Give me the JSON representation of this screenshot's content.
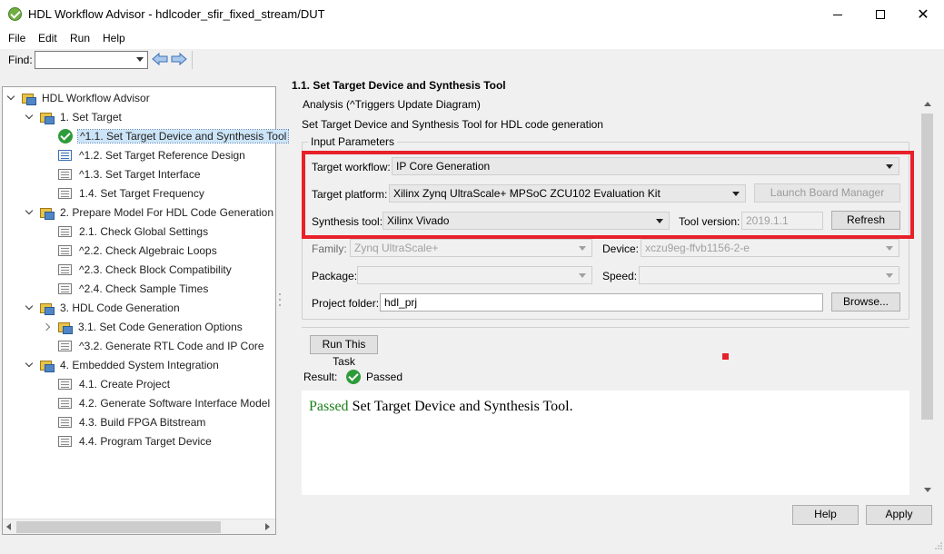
{
  "window": {
    "title": "HDL Workflow Advisor - hdlcoder_sfir_fixed_stream/DUT"
  },
  "menu": {
    "items": [
      "File",
      "Edit",
      "Run",
      "Help"
    ]
  },
  "findbar": {
    "label": "Find:",
    "value": ""
  },
  "tree": {
    "root": "HDL Workflow Advisor",
    "items": [
      {
        "label": "1. Set Target"
      },
      {
        "label": "^1.1. Set Target Device and Synthesis Tool"
      },
      {
        "label": "^1.2. Set Target Reference Design"
      },
      {
        "label": "^1.3. Set Target Interface"
      },
      {
        "label": "1.4. Set Target Frequency"
      },
      {
        "label": "2. Prepare Model For HDL Code Generation"
      },
      {
        "label": "2.1. Check Global Settings"
      },
      {
        "label": "^2.2. Check Algebraic Loops"
      },
      {
        "label": "^2.3. Check Block Compatibility"
      },
      {
        "label": "^2.4. Check Sample Times"
      },
      {
        "label": "3. HDL Code Generation"
      },
      {
        "label": "3.1. Set Code Generation Options"
      },
      {
        "label": "^3.2. Generate RTL Code and IP Core"
      },
      {
        "label": "4. Embedded System Integration"
      },
      {
        "label": "4.1. Create Project"
      },
      {
        "label": "4.2. Generate Software Interface Model"
      },
      {
        "label": "4.3. Build FPGA Bitstream"
      },
      {
        "label": "4.4. Program Target Device"
      }
    ]
  },
  "panel": {
    "title": "1.1. Set Target Device and Synthesis Tool",
    "analysis": "Analysis (^Triggers Update Diagram)",
    "description": "Set Target Device and Synthesis Tool for HDL code generation",
    "group_label": "Input Parameters",
    "target_workflow": {
      "label": "Target workflow:",
      "value": "IP Core Generation"
    },
    "target_platform": {
      "label": "Target platform:",
      "value": "Xilinx Zynq UltraScale+ MPSoC ZCU102 Evaluation Kit"
    },
    "launch_board_manager": "Launch Board Manager",
    "synthesis_tool": {
      "label": "Synthesis tool:",
      "value": "Xilinx Vivado"
    },
    "tool_version": {
      "label": "Tool version:",
      "value": "2019.1.1"
    },
    "refresh": "Refresh",
    "family": {
      "label": "Family:",
      "value": "Zynq UltraScale+"
    },
    "device": {
      "label": "Device:",
      "value": "xczu9eg-ffvb1156-2-e"
    },
    "package": {
      "label": "Package:",
      "value": ""
    },
    "speed": {
      "label": "Speed:",
      "value": ""
    },
    "project_folder": {
      "label": "Project folder:",
      "value": "hdl_prj"
    },
    "browse": "Browse...",
    "run_task": "Run This Task",
    "result_label": "Result:",
    "result_status": "Passed",
    "result_message_status": "Passed",
    "result_message_text": " Set Target Device and Synthesis Tool."
  },
  "footer": {
    "help": "Help",
    "apply": "Apply"
  },
  "colors": {
    "highlight": "#e8202a",
    "passed": "#1a7f1a",
    "selection": "#cce4f7"
  }
}
